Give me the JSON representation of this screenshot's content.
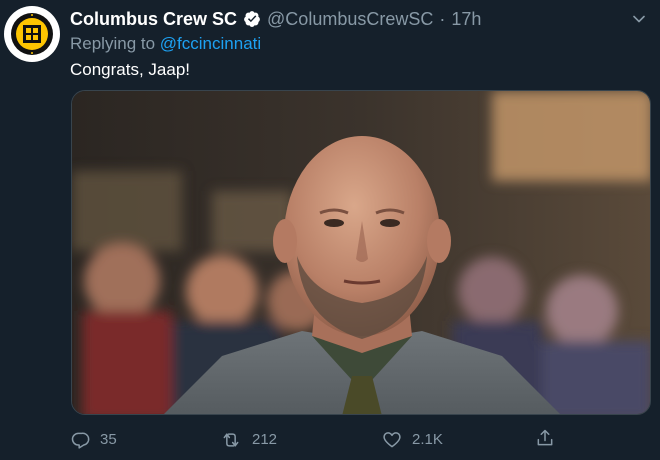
{
  "tweet": {
    "display_name": "Columbus Crew SC",
    "handle": "@ColumbusCrewSC",
    "separator": "·",
    "time": "17h",
    "replying_prefix": "Replying to",
    "replying_to": "@fccincinnati",
    "text": "Congrats, Jaap!",
    "verified": true,
    "avatar": "columbus-crew-crest"
  },
  "media": {
    "subject": "photo"
  },
  "actions": {
    "reply_count": "35",
    "retweet_count": "212",
    "like_count": "2.1K"
  },
  "colors": {
    "background": "#15202b",
    "secondary_text": "#8899a6",
    "link": "#1da1f2",
    "verified": "#ffffff",
    "crest_yellow": "#fec501"
  },
  "icons": {
    "reply": "reply-icon",
    "retweet": "retweet-icon",
    "like": "heart-icon",
    "share": "share-icon",
    "more": "chevron-down-icon",
    "verified": "verified-icon"
  }
}
